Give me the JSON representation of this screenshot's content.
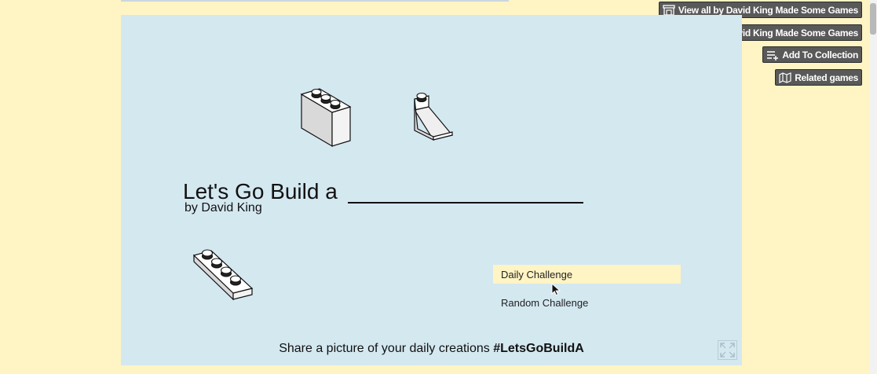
{
  "side_buttons": {
    "view_all": "View all by David King Made Some Games",
    "follow": "Follow David King Made Some Games",
    "add_collection": "Add To Collection",
    "related": "Related games"
  },
  "game": {
    "title": "Let's Go Build a",
    "byline": "by David King",
    "menu": {
      "daily": "Daily Challenge",
      "random": "Random Challenge"
    },
    "share_text": "Share a picture of your daily creations",
    "share_tag": "#LetsGoBuildA"
  },
  "colors": {
    "page_bg": "#fff4c4",
    "game_bg": "#d4e8f0",
    "button_bg": "#595959"
  }
}
